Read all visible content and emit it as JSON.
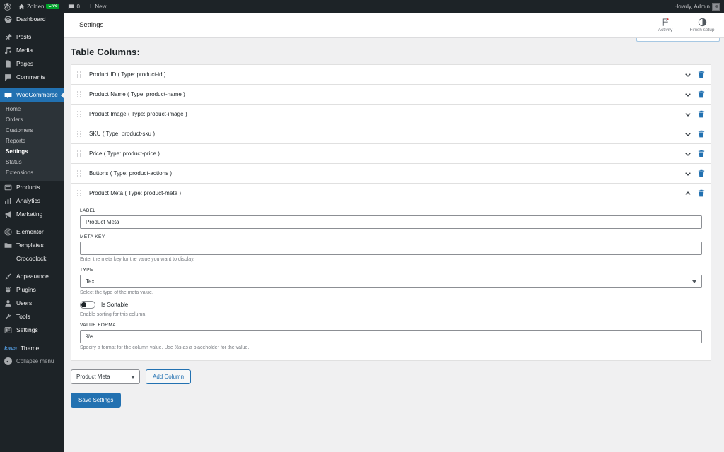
{
  "adminbar": {
    "logo_icon": "wordpress-logo-icon",
    "site_icon": "home-icon",
    "site_name": "Zolden",
    "live_badge": "Live",
    "comments_icon": "comment-bubble-icon",
    "comments_count": "0",
    "new_plus": "+",
    "new_label": "New",
    "howdy": "Howdy, Admin",
    "avatar_icon": "avatar-icon"
  },
  "sidebar": {
    "items": [
      {
        "label": "Dashboard",
        "icon": "dashboard-icon",
        "current": false
      },
      {
        "label": "Posts",
        "icon": "pin-icon",
        "current": false
      },
      {
        "label": "Media",
        "icon": "media-icon",
        "current": false
      },
      {
        "label": "Pages",
        "icon": "page-icon",
        "current": false
      },
      {
        "label": "Comments",
        "icon": "comment-icon",
        "current": false
      },
      {
        "label": "WooCommerce",
        "icon": "woocommerce-icon",
        "current": true
      },
      {
        "label": "Products",
        "icon": "products-icon",
        "current": false
      },
      {
        "label": "Analytics",
        "icon": "analytics-bars-icon",
        "current": false
      },
      {
        "label": "Marketing",
        "icon": "megaphone-icon",
        "current": false
      },
      {
        "label": "Elementor",
        "icon": "elementor-icon",
        "current": false
      },
      {
        "label": "Templates",
        "icon": "folder-icon",
        "current": false
      },
      {
        "label": "Crocoblock",
        "icon": "moon-icon",
        "current": false
      },
      {
        "label": "Appearance",
        "icon": "paintbrush-icon",
        "current": false
      },
      {
        "label": "Plugins",
        "icon": "plug-icon",
        "current": false
      },
      {
        "label": "Users",
        "icon": "user-icon",
        "current": false
      },
      {
        "label": "Tools",
        "icon": "wrench-icon",
        "current": false
      },
      {
        "label": "Settings",
        "icon": "sliders-icon",
        "current": false
      }
    ],
    "submenu": [
      {
        "label": "Home",
        "current": false
      },
      {
        "label": "Orders",
        "current": false
      },
      {
        "label": "Customers",
        "current": false
      },
      {
        "label": "Reports",
        "current": false
      },
      {
        "label": "Settings",
        "current": true
      },
      {
        "label": "Status",
        "current": false
      },
      {
        "label": "Extensions",
        "current": false
      }
    ],
    "theme_logo": "kava",
    "theme_label": "Theme",
    "collapse_label": "Collapse menu",
    "collapse_icon": "collapse-arrow-icon",
    "accent_color": "#2271b1"
  },
  "header": {
    "title": "Settings",
    "actions": [
      {
        "label": "Activity",
        "icon": "flag-activity-icon"
      },
      {
        "label": "Finish setup",
        "icon": "progress-circle-icon"
      }
    ]
  },
  "main": {
    "page_title": "Table Columns:",
    "columns": [
      {
        "name": "Product ID ( Type: product-id )",
        "expanded": false,
        "chevron": "chevron-down-icon"
      },
      {
        "name": "Product Name ( Type: product-name )",
        "expanded": false,
        "chevron": "chevron-down-icon"
      },
      {
        "name": "Product Image ( Type: product-image )",
        "expanded": false,
        "chevron": "chevron-down-icon"
      },
      {
        "name": "SKU ( Type: product-sku )",
        "expanded": false,
        "chevron": "chevron-down-icon"
      },
      {
        "name": "Price ( Type: product-price )",
        "expanded": false,
        "chevron": "chevron-down-icon"
      },
      {
        "name": "Buttons ( Type: product-actions )",
        "expanded": false,
        "chevron": "chevron-down-icon"
      },
      {
        "name": "Product Meta ( Type: product-meta )",
        "expanded": true,
        "chevron": "chevron-up-icon"
      }
    ],
    "panel": {
      "label_field_label": "LABEL",
      "label_field_value": "Product Meta",
      "meta_key_label": "META KEY",
      "meta_key_value": "",
      "meta_key_help": "Enter the meta key for the value you want to display.",
      "type_label": "TYPE",
      "type_value": "Text",
      "type_help": "Select the type of the meta value.",
      "sortable_label": "Is Sortable",
      "sortable_state": "off",
      "sortable_help": "Enable sorting for this column.",
      "value_format_label": "VALUE FORMAT",
      "value_format_value": "%s",
      "value_format_help": "Specify a format for the column value. Use %s as a placeholder for the value."
    },
    "bottom": {
      "add_select_value": "Product Meta",
      "add_button": "Add Column",
      "save_button": "Save Settings"
    },
    "delete_icon": "trash-icon",
    "drag_icon": "drag-handle-icon"
  }
}
